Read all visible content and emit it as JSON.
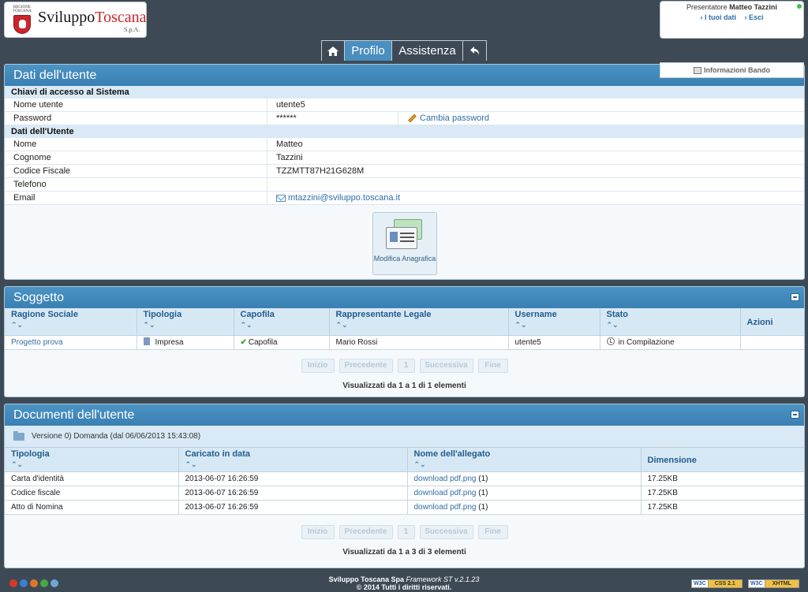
{
  "header": {
    "logo": {
      "region": "REGIONE TOSCANA",
      "brand_black": "Sviluppo",
      "brand_red": "Toscana",
      "brand_sub": "S.p.A."
    },
    "user": {
      "role": "Presentatore",
      "name": "Matteo Tazzini",
      "my_data": "› I tuoi dati",
      "logout": "› Esci"
    },
    "nav": {
      "home_icon": "home-icon",
      "profilo": "Profilo",
      "assistenza": "Assistenza",
      "back_icon": "back-arrow-icon",
      "active": "Profilo"
    },
    "info_bando": "Informazioni Bando"
  },
  "user_panel": {
    "title": "Dati dell'utente",
    "access_title": "Chiavi di accesso al Sistema",
    "username_label": "Nome utente",
    "username_value": "utente5",
    "password_label": "Password",
    "password_value": "******",
    "change_password": "Cambia password",
    "data_title": "Dati dell'Utente",
    "fields": [
      {
        "label": "Nome",
        "value": "Matteo"
      },
      {
        "label": "Cognome",
        "value": "Tazzini"
      },
      {
        "label": "Codice Fiscale",
        "value": "TZZMTT87H21G628M"
      },
      {
        "label": "Telefono",
        "value": ""
      },
      {
        "label": "Email",
        "value": "mtazzini@sviluppo.toscana.it"
      }
    ],
    "modify_button": "Modifica Anagrafica"
  },
  "soggetto_panel": {
    "title": "Soggetto",
    "columns": [
      "Ragione Sociale",
      "Tipologia",
      "Capofila",
      "Rappresentante Legale",
      "Username",
      "Stato",
      "Azioni"
    ],
    "rows": [
      {
        "ragione_sociale": "Progetto prova",
        "tipologia": "Impresa",
        "capofila": "Capofila",
        "rappresentante": "Mario Rossi",
        "username": "utente5",
        "stato": "in Compilazione",
        "azioni": ""
      }
    ],
    "pager": {
      "first": "Inizio",
      "prev": "Precedente",
      "page": "1",
      "next": "Successiva",
      "last": "Fine"
    },
    "info": "Visualizzati da 1 a 1 di 1 elementi"
  },
  "documenti_panel": {
    "title": "Documenti dell'utente",
    "version": "Versione 0) Domanda (dal 06/06/2013 15:43:08)",
    "columns": [
      "Tipologia",
      "Caricato in data",
      "Nome dell'allegato",
      "Dimensione"
    ],
    "rows": [
      {
        "tipologia": "Carta d'identità",
        "data": "2013-06-07 16:26:59",
        "file": "download pdf.png",
        "count": "(1)",
        "size": "17.25KB"
      },
      {
        "tipologia": "Codice fiscale",
        "data": "2013-06-07 16:26:59",
        "file": "download pdf.png",
        "count": "(1)",
        "size": "17.25KB"
      },
      {
        "tipologia": "Atto di Nomina",
        "data": "2013-06-07 16:26:59",
        "file": "download pdf.png",
        "count": "(1)",
        "size": "17.25KB"
      }
    ],
    "pager": {
      "first": "Inizio",
      "prev": "Precedente",
      "page": "1",
      "next": "Successiva",
      "last": "Fine"
    },
    "info": "Visualizzati da 1 a 3 di 3 elementi"
  },
  "footer": {
    "company": "Sviluppo Toscana Spa",
    "framework": "Framework ST v.2.1.23",
    "copyright": "© 2014 Tutti i diritti riservati.",
    "badge_w3c": "W3C",
    "badge_css": "CSS 2.1",
    "badge_xhtml": "XHTML"
  },
  "colors": {
    "header_bg": "#3d4a55",
    "panel_head": "#3a7fb2",
    "link": "#2f6ea6",
    "table_head": "#d7e8f5"
  }
}
